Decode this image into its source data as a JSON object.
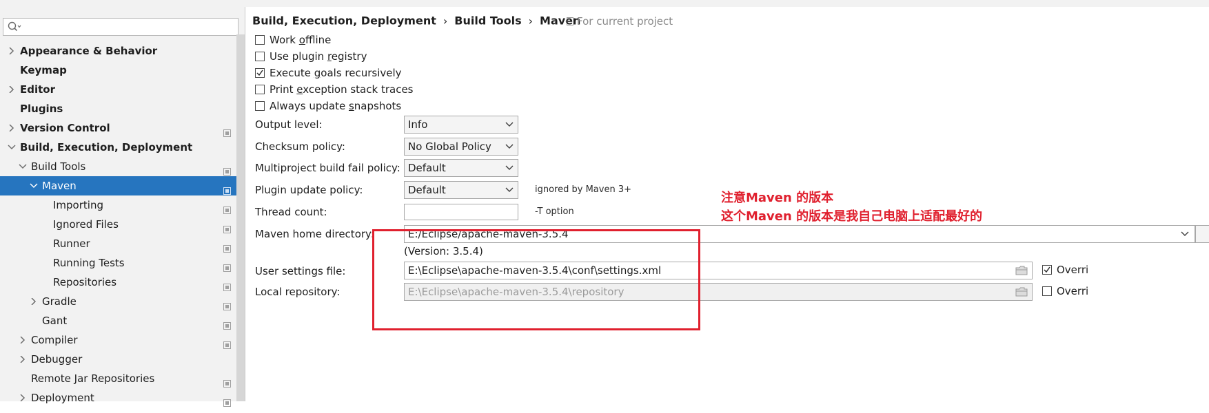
{
  "search": {
    "value": ""
  },
  "sidebar": {
    "items": [
      {
        "label": "Appearance & Behavior",
        "bold": true,
        "arrow": "right",
        "proj": false
      },
      {
        "label": "Keymap",
        "bold": true,
        "arrow": "none",
        "proj": false
      },
      {
        "label": "Editor",
        "bold": true,
        "arrow": "right",
        "proj": false
      },
      {
        "label": "Plugins",
        "bold": true,
        "arrow": "none",
        "proj": false
      },
      {
        "label": "Version Control",
        "bold": true,
        "arrow": "right",
        "proj": true
      },
      {
        "label": "Build, Execution, Deployment",
        "bold": true,
        "arrow": "down",
        "proj": false
      },
      {
        "label": "Build Tools",
        "bold": false,
        "arrow": "down",
        "proj": true
      },
      {
        "label": "Maven",
        "bold": false,
        "arrow": "down",
        "proj": true,
        "selected": true
      },
      {
        "label": "Importing",
        "bold": false,
        "arrow": "none",
        "proj": true
      },
      {
        "label": "Ignored Files",
        "bold": false,
        "arrow": "none",
        "proj": true
      },
      {
        "label": "Runner",
        "bold": false,
        "arrow": "none",
        "proj": true
      },
      {
        "label": "Running Tests",
        "bold": false,
        "arrow": "none",
        "proj": true
      },
      {
        "label": "Repositories",
        "bold": false,
        "arrow": "none",
        "proj": true
      },
      {
        "label": "Gradle",
        "bold": false,
        "arrow": "right",
        "proj": true
      },
      {
        "label": "Gant",
        "bold": false,
        "arrow": "none",
        "proj": true
      },
      {
        "label": "Compiler",
        "bold": false,
        "arrow": "right",
        "proj": true
      },
      {
        "label": "Debugger",
        "bold": false,
        "arrow": "right",
        "proj": false
      },
      {
        "label": "Remote Jar Repositories",
        "bold": false,
        "arrow": "none",
        "proj": true
      },
      {
        "label": "Deployment",
        "bold": false,
        "arrow": "right",
        "proj": true
      }
    ]
  },
  "breadcrumb": {
    "part1": "Build, Execution, Deployment",
    "part2": "Build Tools",
    "part3": "Maven",
    "separator": "›"
  },
  "scope_label": "For current project",
  "checkboxes": {
    "work_offline": {
      "before": "Work ",
      "mnemonic": "o",
      "after": "ffline",
      "checked": false
    },
    "use_plugin_registry": {
      "before": "Use plugin ",
      "mnemonic": "r",
      "after": "egistry",
      "checked": false
    },
    "execute_goals": {
      "before": "Execute ",
      "mnemonic": "g",
      "after": "oals recursively",
      "checked": true
    },
    "print_exception": {
      "before": "Print ",
      "mnemonic": "e",
      "after": "xception stack traces",
      "checked": false
    },
    "always_update": {
      "before": "Always update ",
      "mnemonic": "s",
      "after": "napshots",
      "checked": false
    }
  },
  "fields": {
    "output_level": {
      "label": "Output level:",
      "value": "Info"
    },
    "checksum_policy": {
      "label": "Checksum policy:",
      "value": "No Global Policy"
    },
    "multiproject_fail": {
      "label": "Multiproject build fail policy:",
      "value": "Default"
    },
    "plugin_update": {
      "label": "Plugin update policy:",
      "value": "Default",
      "hint": "ignored by Maven 3+"
    },
    "thread_count": {
      "label": "Thread count:",
      "value": "",
      "hint": "-T option"
    },
    "maven_home": {
      "label": "Maven home directory:",
      "value": "E:/Eclipse/apache-maven-3.5.4",
      "version": "(Version: 3.5.4)"
    },
    "user_settings": {
      "label": "User settings file:",
      "value": "E:\\Eclipse\\apache-maven-3.5.4\\conf\\settings.xml",
      "override": "Overri",
      "override_checked": true
    },
    "local_repo": {
      "label": "Local repository:",
      "value": "E:\\Eclipse\\apache-maven-3.5.4\\repository",
      "override": "Overri",
      "override_checked": false
    }
  },
  "annotation": {
    "line1": "注意Maven 的版本",
    "line2": "这个Maven 的版本是我自己电脑上适配最好的",
    "color": "#e0202e"
  },
  "colors": {
    "selection": "#2675bf",
    "sidebar_bg": "#f2f2f2"
  }
}
